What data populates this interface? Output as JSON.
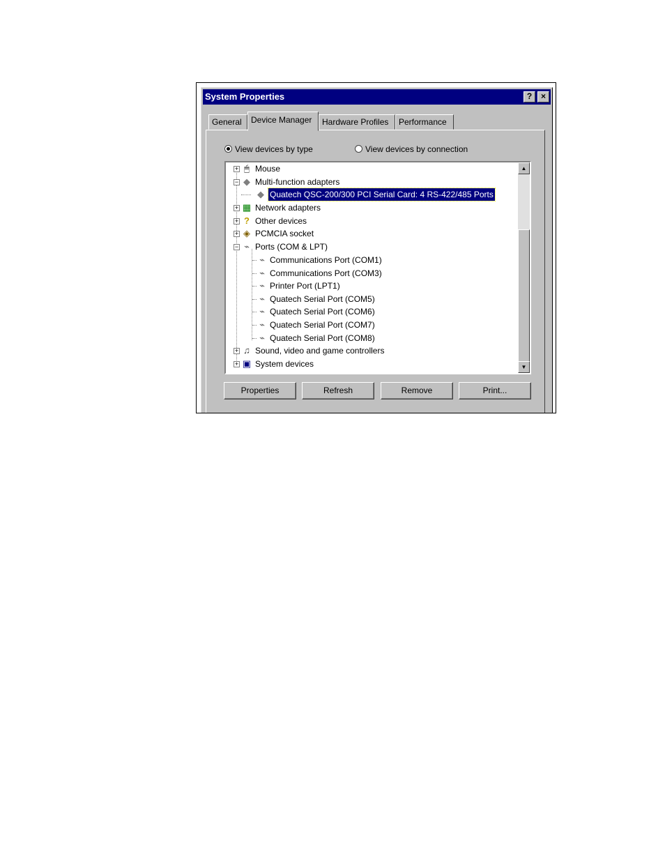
{
  "window": {
    "title": "System Properties",
    "help_glyph": "?",
    "close_glyph": "×"
  },
  "tabs": [
    "General",
    "Device Manager",
    "Hardware Profiles",
    "Performance"
  ],
  "active_tab": "Device Manager",
  "view": {
    "by_type": "View devices by type",
    "by_connection": "View devices by connection",
    "selected": "by_type"
  },
  "tree": {
    "items": [
      {
        "label": "Mouse",
        "icon": "mouse-icon",
        "level": 0,
        "expander": "+"
      },
      {
        "label": "Multi-function adapters",
        "icon": "multifunction-adapter-icon",
        "level": 0,
        "expander": "−"
      },
      {
        "label": "Quatech QSC-200/300 PCI Serial Card: 4 RS-422/485 Ports",
        "icon": "multifunction-adapter-icon",
        "level": 1,
        "selected": true
      },
      {
        "label": "Network adapters",
        "icon": "network-adapter-icon",
        "level": 0,
        "expander": "+"
      },
      {
        "label": "Other devices",
        "icon": "question-mark-icon",
        "level": 0,
        "expander": "+"
      },
      {
        "label": "PCMCIA socket",
        "icon": "pcmcia-socket-icon",
        "level": 0,
        "expander": "+"
      },
      {
        "label": "Ports (COM & LPT)",
        "icon": "port-connector-icon",
        "level": 0,
        "expander": "−"
      },
      {
        "label": "Communications Port (COM1)",
        "icon": "port-connector-icon",
        "level": 1
      },
      {
        "label": "Communications Port (COM3)",
        "icon": "port-connector-icon",
        "level": 1
      },
      {
        "label": "Printer Port (LPT1)",
        "icon": "port-connector-icon",
        "level": 1
      },
      {
        "label": "Quatech Serial Port (COM5)",
        "icon": "port-connector-icon",
        "level": 1
      },
      {
        "label": "Quatech Serial Port (COM6)",
        "icon": "port-connector-icon",
        "level": 1
      },
      {
        "label": "Quatech Serial Port (COM7)",
        "icon": "port-connector-icon",
        "level": 1
      },
      {
        "label": "Quatech Serial Port (COM8)",
        "icon": "port-connector-icon",
        "level": 1
      },
      {
        "label": "Sound, video and game controllers",
        "icon": "sound-video-game-icon",
        "level": 0,
        "expander": "+"
      },
      {
        "label": "System devices",
        "icon": "computer-icon",
        "level": 0,
        "expander": "+"
      }
    ]
  },
  "scrollbar": {
    "up_glyph": "▲",
    "down_glyph": "▼"
  },
  "buttons": {
    "properties": "Properties",
    "refresh": "Refresh",
    "remove": "Remove",
    "print": "Print..."
  },
  "colors": {
    "selection": "#000080",
    "title_bar": "#000080",
    "face": "#c0c0c0"
  }
}
